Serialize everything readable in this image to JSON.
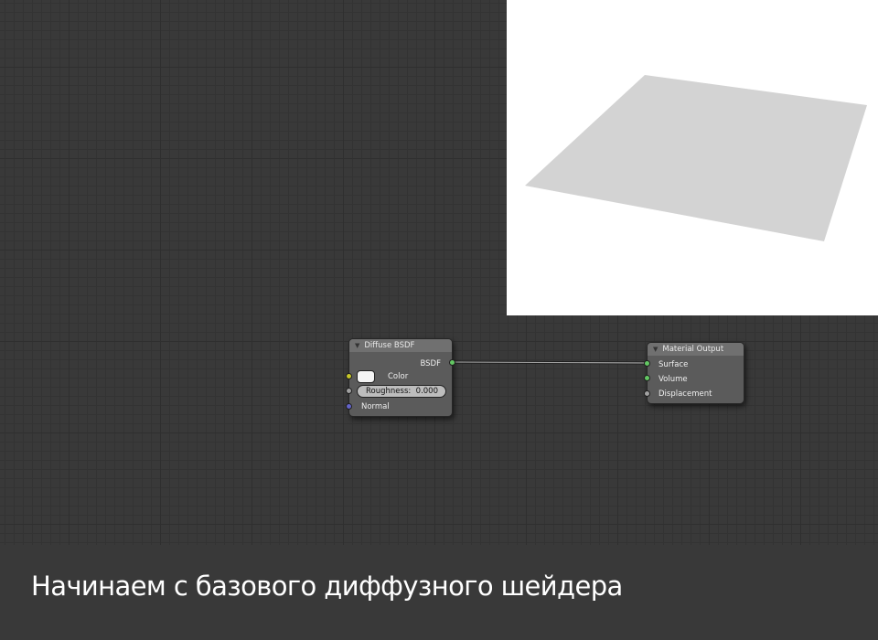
{
  "preview": {
    "plane_color": "#d3d3d3",
    "background_color": "#ffffff"
  },
  "diffuse_node": {
    "title": "Diffuse BSDF",
    "output_label": "BSDF",
    "color_label": "Color",
    "roughness_label": "Roughness:",
    "roughness_value": "0.000",
    "normal_label": "Normal",
    "color_value": "#f4f4f4"
  },
  "output_node": {
    "title": "Material Output",
    "inputs": [
      "Surface",
      "Volume",
      "Displacement"
    ]
  },
  "colors": {
    "shader_socket": "#63c763",
    "color_socket": "#c7c729",
    "value_socket": "#a1a1a1",
    "vector_socket": "#6363c7",
    "link": "#a0a0a0"
  },
  "caption": "Начинаем с базового диффузного шейдера"
}
